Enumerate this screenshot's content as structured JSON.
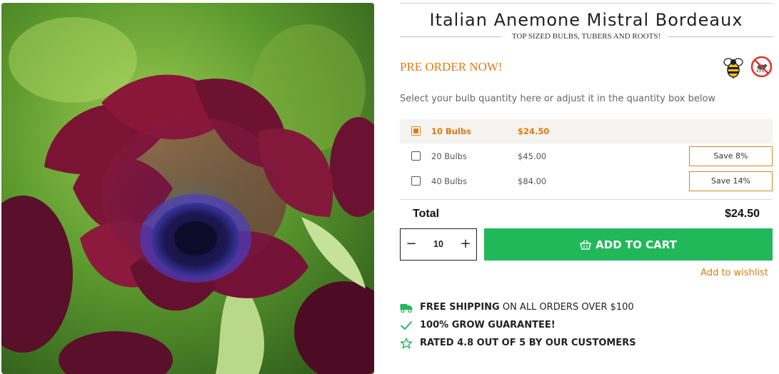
{
  "product": {
    "title": "Italian Anemone Mistral Bordeaux",
    "subtitle": "TOP SIZED BULBS, TUBERS AND ROOTS!",
    "preorder_label": "PRE ORDER NOW!",
    "badges": [
      "bee-friendly-icon",
      "pest-resistant-icon"
    ]
  },
  "quantity_picker": {
    "help_text": "Select your bulb quantity here or adjust it in the quantity box below",
    "options": [
      {
        "quantity": "10 Bulbs",
        "price": "$24.50",
        "save": "",
        "selected": true
      },
      {
        "quantity": "20 Bulbs",
        "price": "$45.00",
        "save": "Save 8%",
        "selected": false
      },
      {
        "quantity": "40 Bulbs",
        "price": "$84.00",
        "save": "Save 14%",
        "selected": false
      }
    ]
  },
  "total": {
    "label": "Total",
    "value": "$24.50"
  },
  "cart": {
    "quantity": "10",
    "minus_label": "−",
    "plus_label": "+",
    "add_to_cart_label": "ADD TO CART",
    "wishlist_label": "Add to wishlist"
  },
  "features": [
    {
      "icon": "truck-icon",
      "bold": "FREE SHIPPING",
      "rest": " ON ALL ORDERS OVER $100"
    },
    {
      "icon": "checkmark-icon",
      "bold": "100% GROW GUARANTEE!",
      "rest": ""
    },
    {
      "icon": "star-icon",
      "bold": "RATED 4.8 OUT OF 5 BY OUR CUSTOMERS",
      "rest": ""
    }
  ],
  "colors": {
    "accent_orange": "#e07b10",
    "cart_green": "#20b859",
    "flower_burgundy": "#7a1030"
  }
}
